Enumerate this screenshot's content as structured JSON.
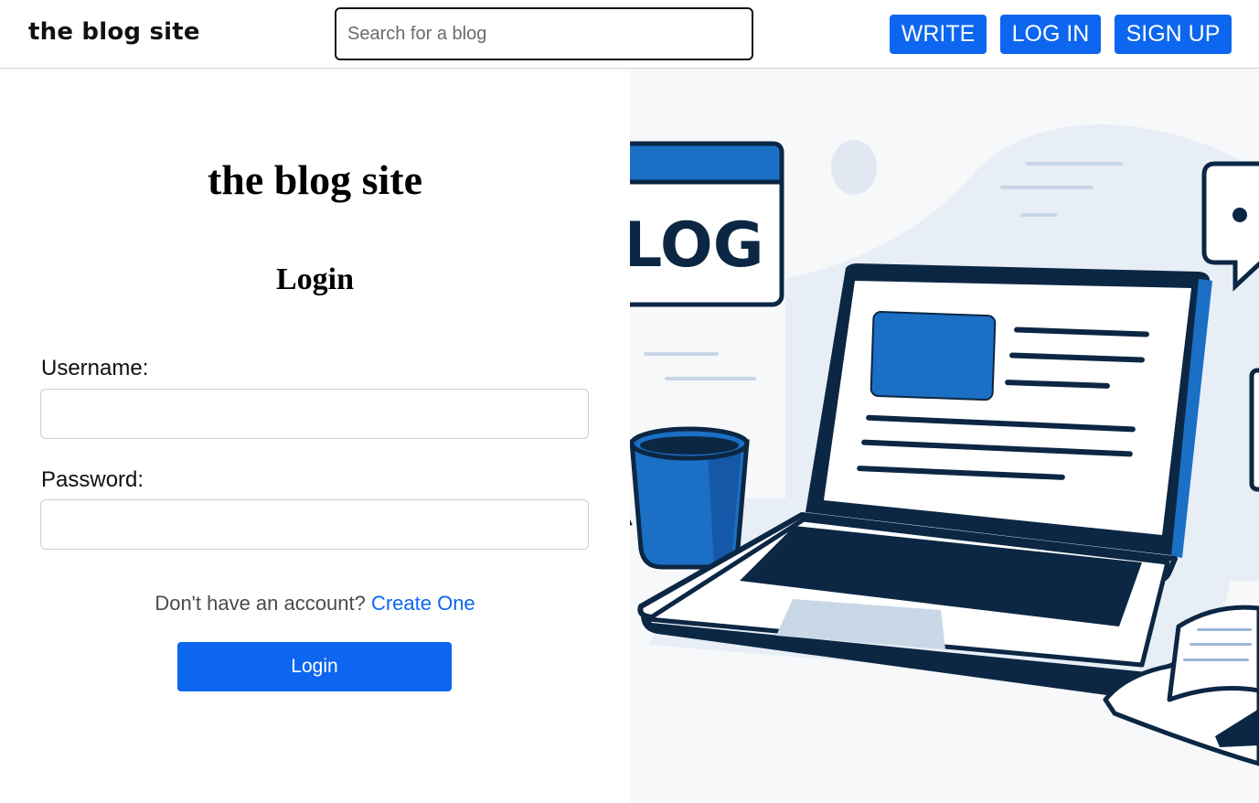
{
  "header": {
    "brand": "the blog site",
    "search_placeholder": "Search for a blog",
    "write_label": "WRITE",
    "login_label": "LOG IN",
    "signup_label": "SIGN UP"
  },
  "form": {
    "site_title": "the blog site",
    "heading": "Login",
    "username_label": "Username:",
    "username_value": "",
    "password_label": "Password:",
    "password_value": "",
    "account_prompt": "Don't have an account?",
    "create_link": "Create One",
    "submit_label": "Login"
  },
  "illustration": {
    "sign_text": "LOG"
  },
  "colors": {
    "accent": "#0d66f0",
    "navy": "#0c2744",
    "illustration_blue": "#1b6fc4",
    "illustration_bg": "#f7f8fa"
  }
}
